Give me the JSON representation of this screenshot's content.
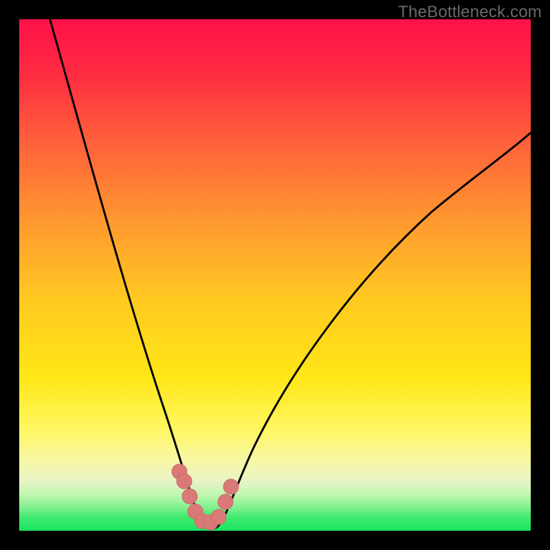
{
  "watermark": "TheBottleneck.com",
  "colors": {
    "frame": "#000000",
    "top": "#ff1149",
    "mid_upper": "#ff8c2a",
    "mid": "#ffe617",
    "pale_yellow": "#f7f7a2",
    "mint": "#bff7b0",
    "green": "#19e560",
    "curve": "#000000",
    "points": "#d97a78"
  },
  "chart_data": {
    "type": "line",
    "title": "",
    "xlabel": "",
    "ylabel": "",
    "xlim": [
      0,
      100
    ],
    "ylim": [
      0,
      100
    ],
    "grid": false,
    "legend": false,
    "series": [
      {
        "name": "bottleneck-curve",
        "x": [
          6,
          10,
          15,
          20,
          25,
          28,
          30,
          32,
          34,
          35,
          36,
          37,
          38,
          40,
          42,
          45,
          50,
          55,
          60,
          65,
          70,
          75,
          80,
          85,
          90,
          95,
          100
        ],
        "y": [
          100,
          88,
          72,
          56,
          38,
          24,
          15,
          8,
          3,
          1,
          0,
          0,
          0,
          1,
          3,
          8,
          18,
          28,
          37,
          45,
          52,
          58,
          63,
          68,
          72,
          75,
          78
        ]
      }
    ],
    "highlight_points": {
      "name": "optimal-range",
      "x": [
        32.5,
        33.2,
        34.5,
        35.5,
        36.5,
        37.8,
        38.8,
        40.0,
        40.8
      ],
      "y": [
        9.5,
        8.0,
        5.0,
        2.5,
        2.0,
        2.0,
        3.5,
        5.5,
        8.0
      ]
    },
    "annotations": []
  }
}
